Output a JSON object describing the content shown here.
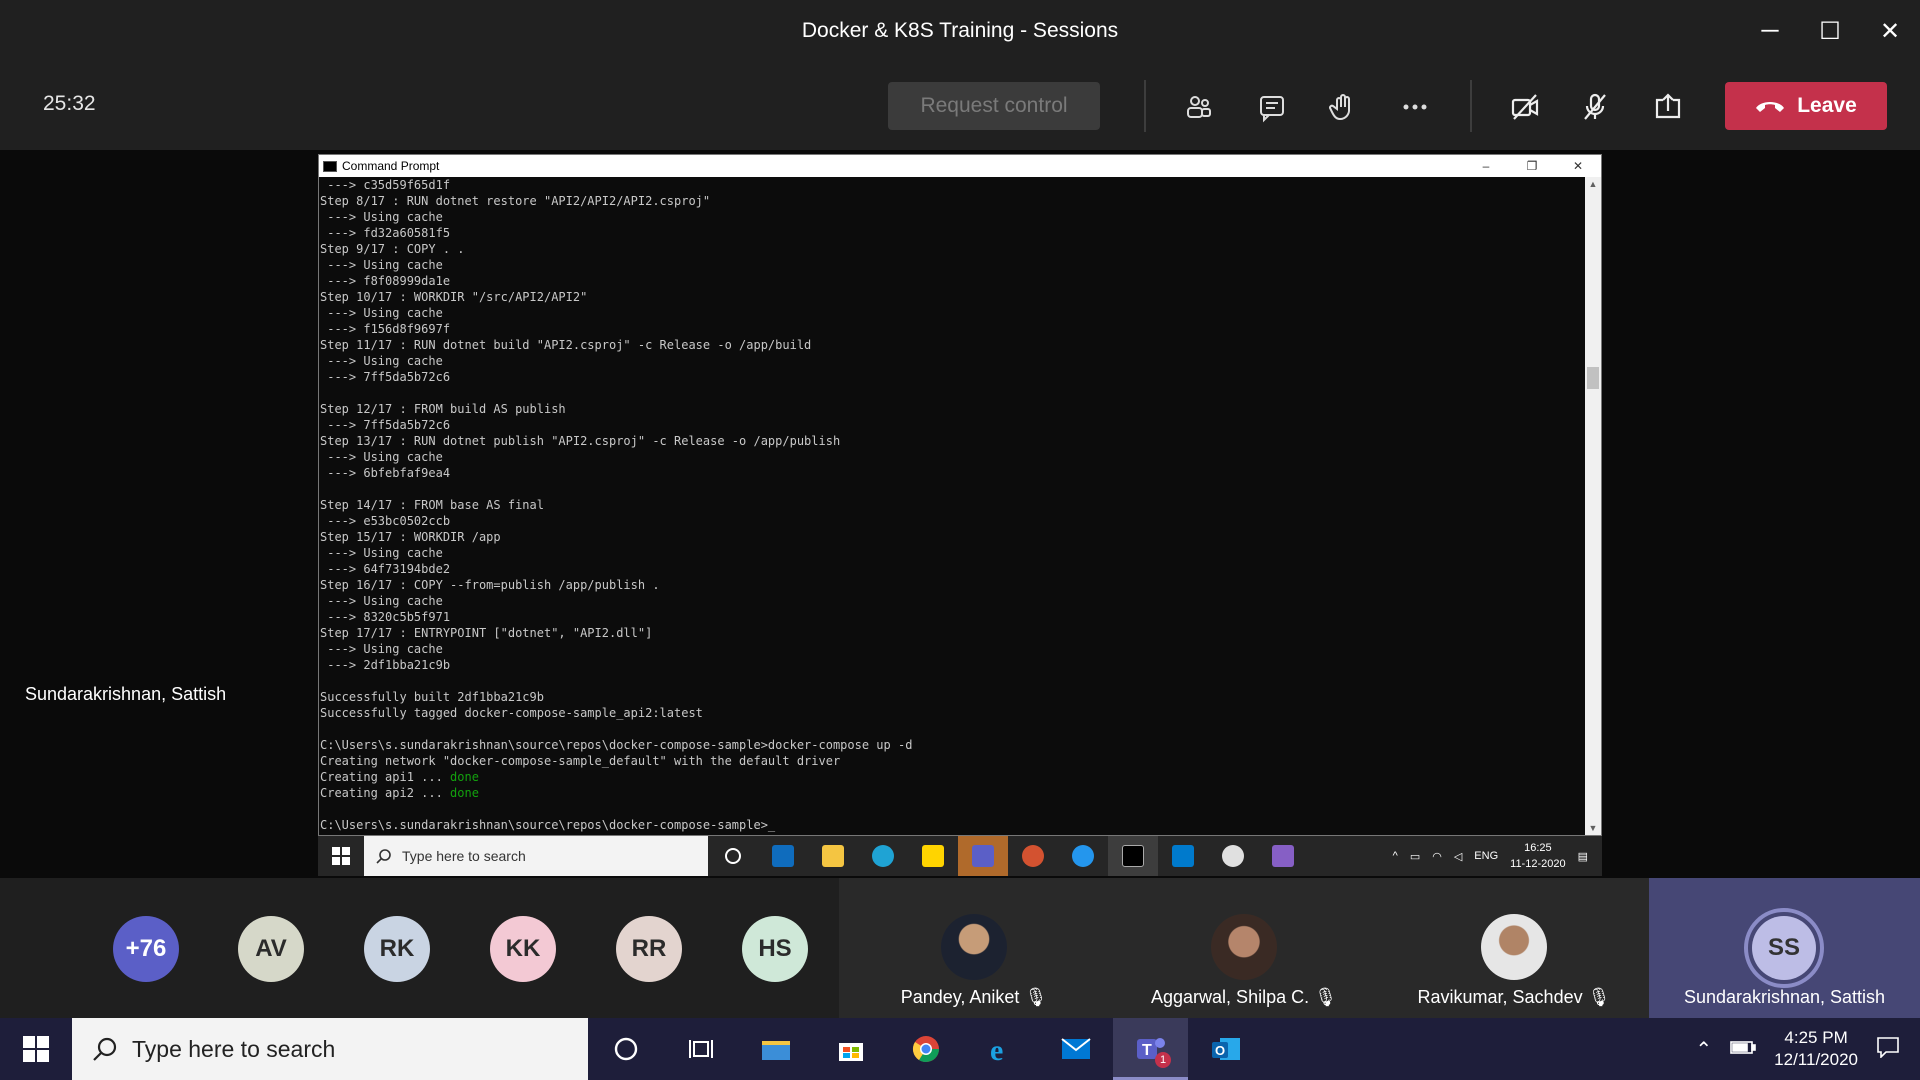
{
  "window": {
    "title": "Docker & K8S Training - Sessions",
    "minimize": "─",
    "maximize": "☐",
    "close": "✕"
  },
  "toolbar": {
    "timer": "25:32",
    "request_control": "Request control",
    "leave": "Leave",
    "accent": "#c4314b"
  },
  "stage": {
    "presenter_name": "Sundarakrishnan, Sattish"
  },
  "cmd": {
    "title": "Command Prompt",
    "minimize": "–",
    "restore": "❐",
    "close": "✕",
    "lines": [
      " ---> c35d59f65d1f",
      "Step 8/17 : RUN dotnet restore \"API2/API2/API2.csproj\"",
      " ---> Using cache",
      " ---> fd32a60581f5",
      "Step 9/17 : COPY . .",
      " ---> Using cache",
      " ---> f8f08999da1e",
      "Step 10/17 : WORKDIR \"/src/API2/API2\"",
      " ---> Using cache",
      " ---> f156d8f9697f",
      "Step 11/17 : RUN dotnet build \"API2.csproj\" -c Release -o /app/build",
      " ---> Using cache",
      " ---> 7ff5da5b72c6",
      "",
      "Step 12/17 : FROM build AS publish",
      " ---> 7ff5da5b72c6",
      "Step 13/17 : RUN dotnet publish \"API2.csproj\" -c Release -o /app/publish",
      " ---> Using cache",
      " ---> 6bfebfaf9ea4",
      "",
      "Step 14/17 : FROM base AS final",
      " ---> e53bc0502ccb",
      "Step 15/17 : WORKDIR /app",
      " ---> Using cache",
      " ---> 64f73194bde2",
      "Step 16/17 : COPY --from=publish /app/publish .",
      " ---> Using cache",
      " ---> 8320c5b5f971",
      "Step 17/17 : ENTRYPOINT [\"dotnet\", \"API2.dll\"]",
      " ---> Using cache",
      " ---> 2df1bba21c9b",
      "",
      "Successfully built 2df1bba21c9b",
      "Successfully tagged docker-compose-sample_api2:latest",
      "",
      "C:\\Users\\s.sundarakrishnan\\source\\repos\\docker-compose-sample>docker-compose up -d",
      "Creating network \"docker-compose-sample_default\" with the default driver",
      "Creating api1 ... ",
      "Creating api2 ... ",
      "",
      "C:\\Users\\s.sundarakrishnan\\source\\repos\\docker-compose-sample>_"
    ],
    "done_label": "done",
    "done_color": "#13a10e"
  },
  "remote_taskbar": {
    "search_placeholder": "Type here to search",
    "lang": "ENG",
    "time": "16:25",
    "date": "11-12-2020"
  },
  "participants": {
    "overflow": "+76",
    "avatars": [
      {
        "initials": "AV",
        "color": "#d6d8c9"
      },
      {
        "initials": "RK",
        "color": "#c9d4e3"
      },
      {
        "initials": "KK",
        "color": "#f3c9d4"
      },
      {
        "initials": "RR",
        "color": "#e3d4cf"
      },
      {
        "initials": "HS",
        "color": "#cfe8d8"
      }
    ],
    "tiles": [
      {
        "name": "Pandey, Aniket"
      },
      {
        "name": "Aggarwal, Shilpa C."
      },
      {
        "name": "Ravikumar, Sachdev"
      },
      {
        "name": "Sundarakrishnan, Sattish",
        "initials": "SS"
      }
    ]
  },
  "taskbar": {
    "search_placeholder": "Type here to search",
    "time": "4:25 PM",
    "date": "12/11/2020",
    "teams_badge": "1"
  }
}
